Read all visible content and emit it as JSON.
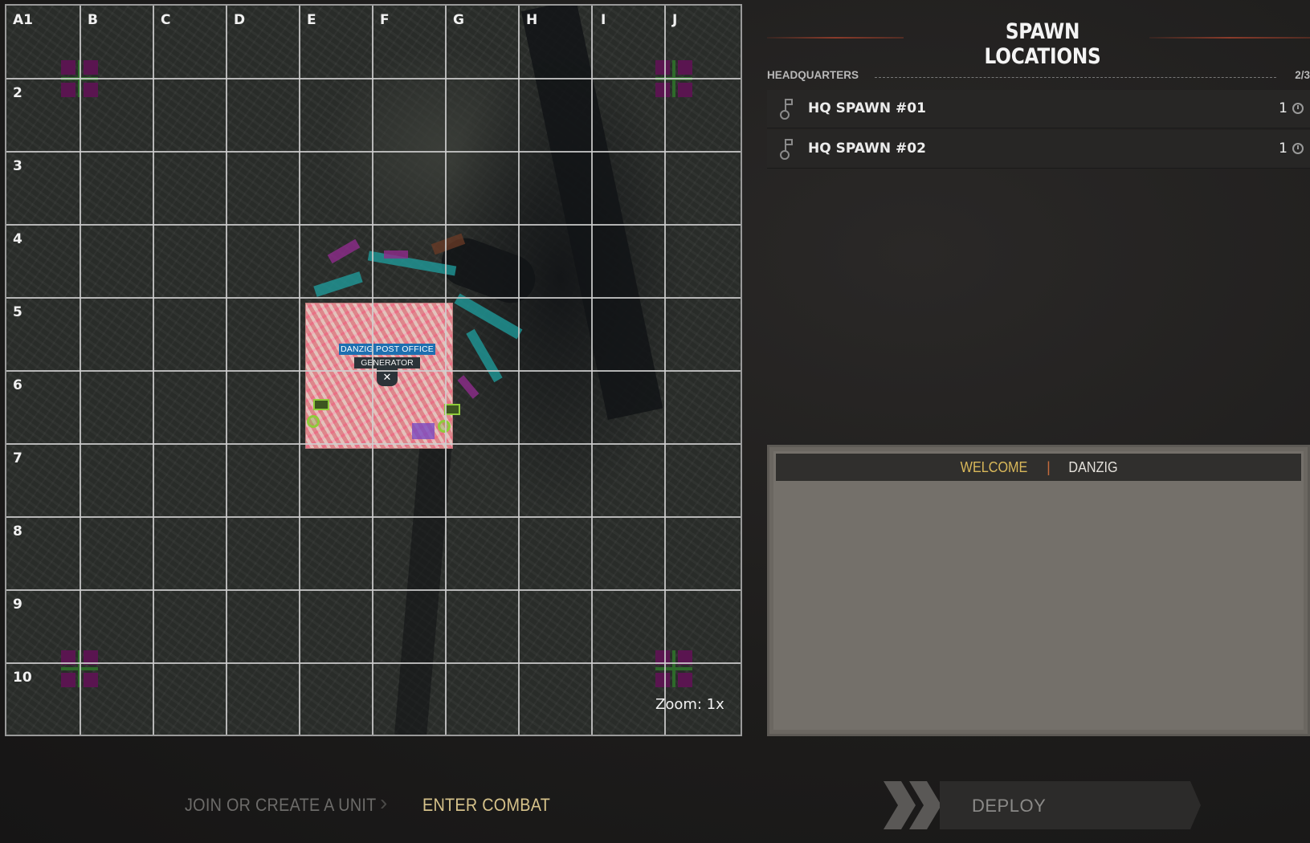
{
  "map": {
    "columns": [
      "A1",
      "B",
      "C",
      "D",
      "E",
      "F",
      "G",
      "H",
      "I",
      "J"
    ],
    "rows": [
      "2",
      "3",
      "4",
      "5",
      "6",
      "7",
      "8",
      "9",
      "10"
    ],
    "objective": {
      "name": "DANZIG POST OFFICE",
      "subtitle": "GENERATOR"
    },
    "zoom_label": "Zoom: 1x"
  },
  "panel": {
    "title": "SPAWN LOCATIONS",
    "section": {
      "label": "HEADQUARTERS",
      "count": "2/3"
    },
    "spawns": [
      {
        "label": "HQ SPAWN #01",
        "count": "1",
        "icon": "timer-icon"
      },
      {
        "label": "HQ SPAWN #02",
        "count": "1",
        "icon": "timer-icon"
      }
    ]
  },
  "welcome": {
    "tab_active": "WELCOME",
    "separator": "|",
    "tab_map": "DANZIG"
  },
  "nav": {
    "step1": "JOIN OR CREATE A UNIT",
    "step2": "ENTER COMBAT",
    "deploy": "DEPLOY"
  },
  "colors": {
    "accent_gold": "#d9b85a",
    "hq_marker": "#5a1550",
    "spawn_point": "#8fcc3a",
    "objective_label": "#1d6fb0"
  }
}
